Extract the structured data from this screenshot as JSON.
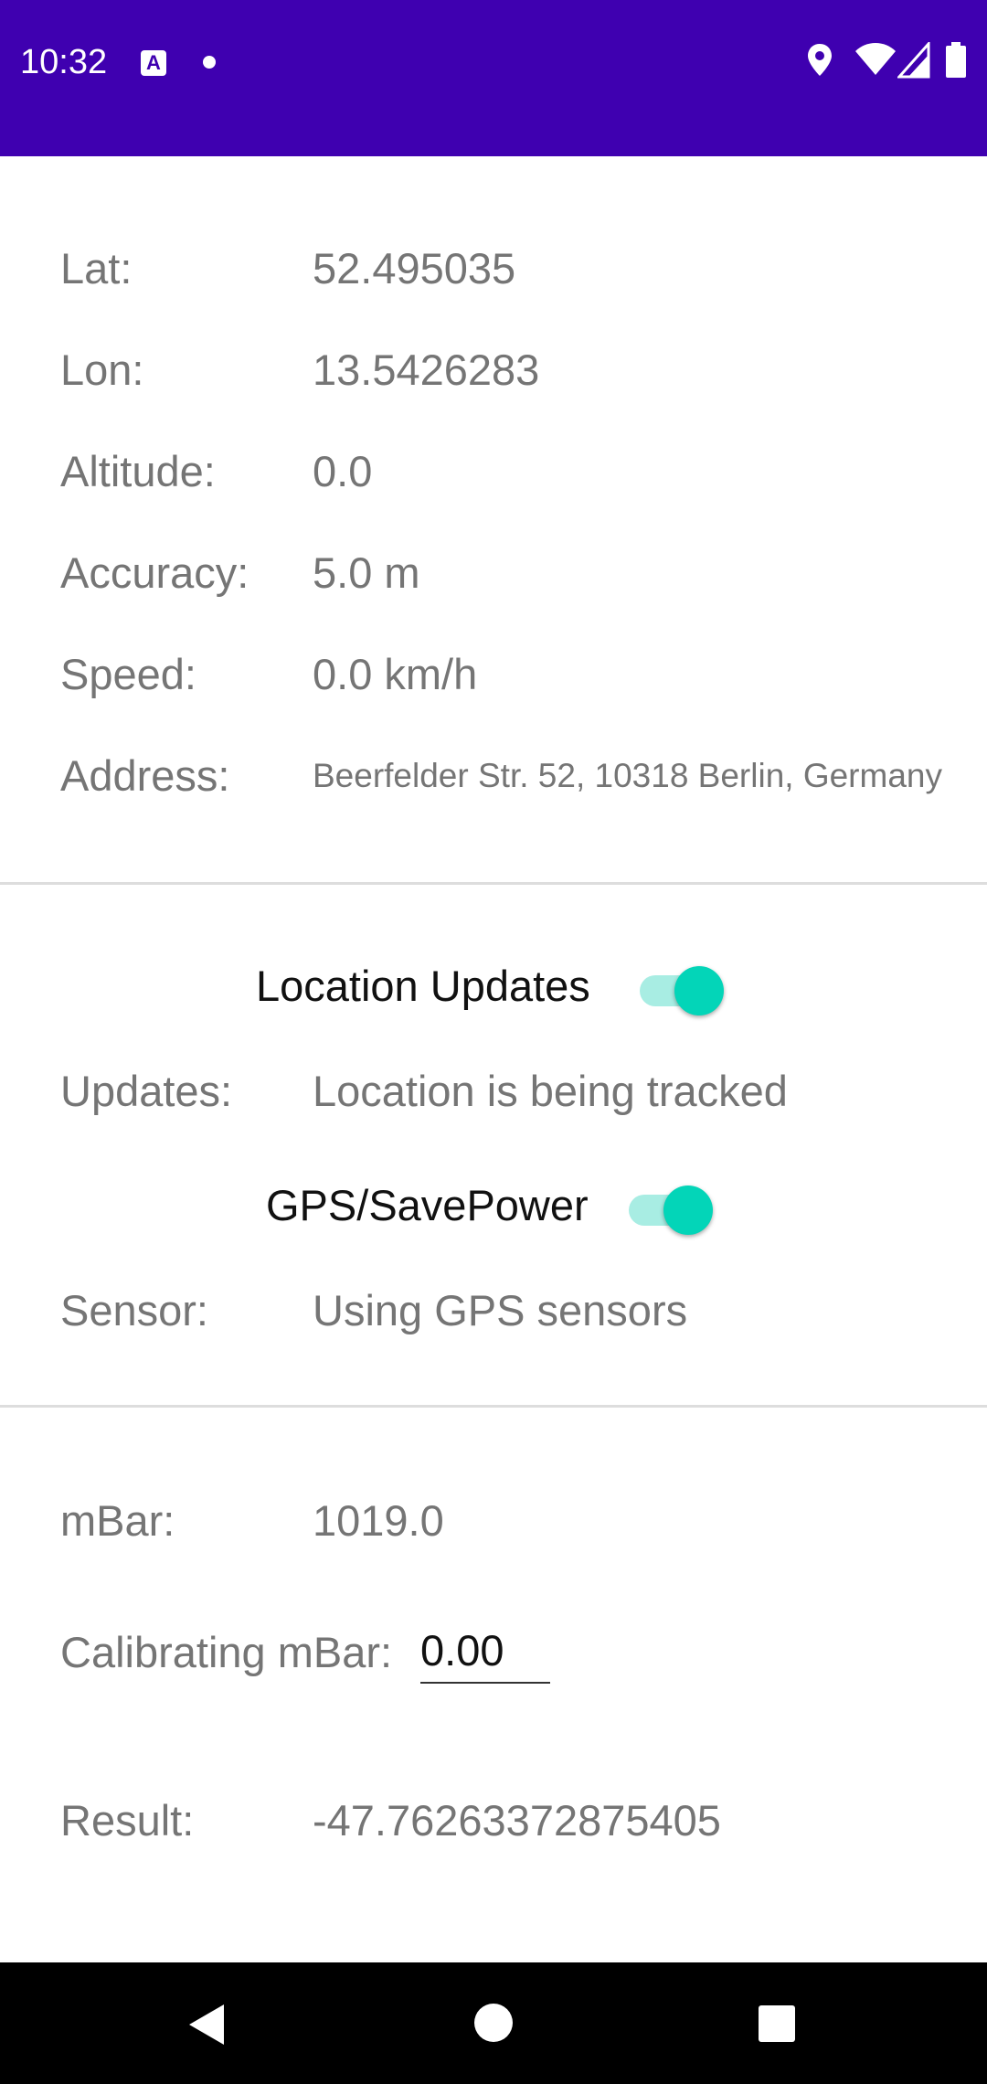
{
  "status_bar": {
    "time": "10:32",
    "app_icon_letter": "A",
    "background_color": "#3F00B0",
    "icons": [
      "notification-a-icon",
      "notification-dot-icon",
      "location-icon",
      "wifi-icon",
      "signal-icon",
      "battery-icon"
    ]
  },
  "location": {
    "lat_label": "Lat:",
    "lat_value": "52.495035",
    "lon_label": "Lon:",
    "lon_value": "13.5426283",
    "altitude_label": "Altitude:",
    "altitude_value": "0.0",
    "accuracy_label": "Accuracy:",
    "accuracy_value": "5.0 m",
    "speed_label": "Speed:",
    "speed_value": "0.0 km/h",
    "address_label": "Address:",
    "address_value": "Beerfelder Str. 52, 10318 Berlin, Germany"
  },
  "updates": {
    "location_updates_label": "Location Updates",
    "location_updates_on": true,
    "updates_label": "Updates:",
    "updates_value": "Location is being tracked",
    "gps_label": "GPS/SavePower",
    "gps_on": true,
    "sensor_label": "Sensor:",
    "sensor_value": "Using GPS sensors",
    "switch_color": "#03D5B8"
  },
  "pressure": {
    "mbar_label": "mBar:",
    "mbar_value": "1019.0",
    "calibrating_label": "Calibrating mBar:",
    "calibrating_value": "0.00",
    "result_label": "Result:",
    "result_value": "-47.76263372875405"
  },
  "nav_bar": {
    "icons": [
      "back-icon",
      "home-icon",
      "recents-icon"
    ]
  }
}
